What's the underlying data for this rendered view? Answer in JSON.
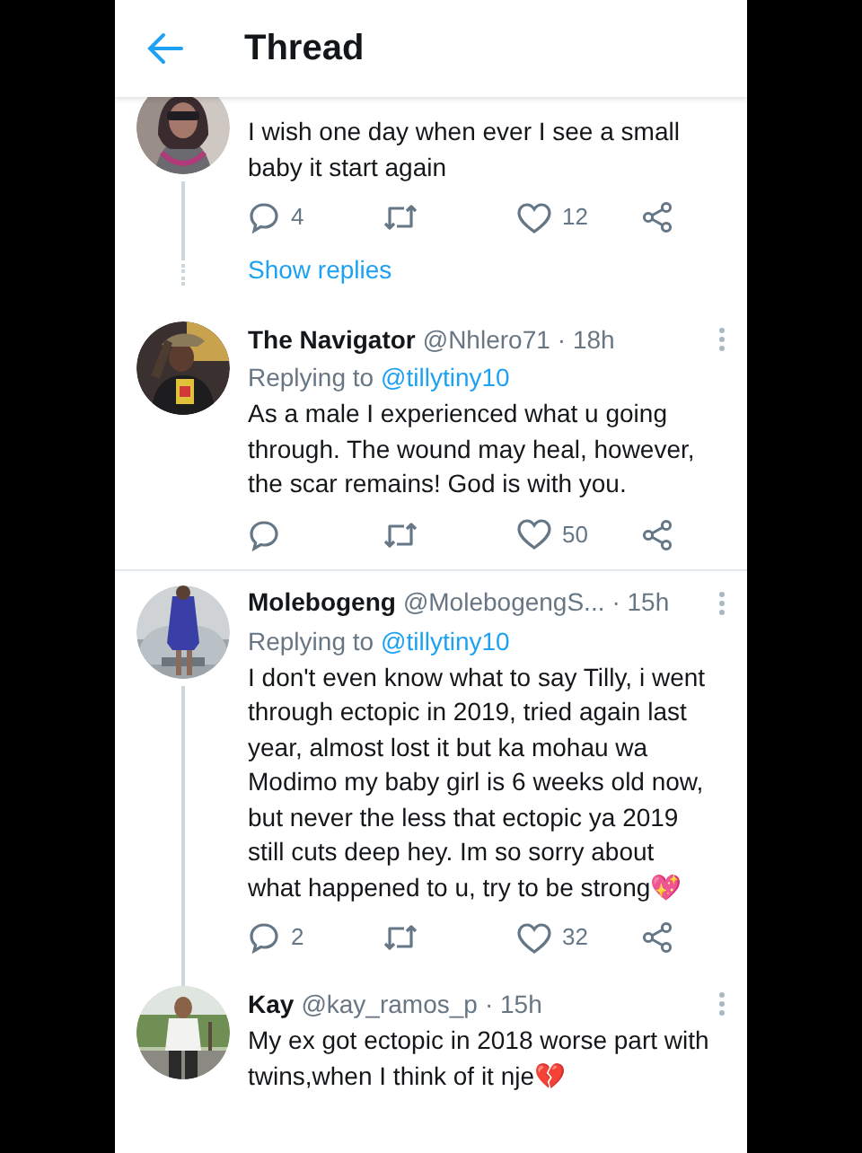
{
  "header": {
    "title": "Thread"
  },
  "tweets": [
    {
      "body": "I wish one day when ever I see a small baby it start again",
      "actions": {
        "replies": "4",
        "likes": "12"
      },
      "show_replies": "Show replies",
      "thread_above": false,
      "thread_below": true
    },
    {
      "name": "The Navigator",
      "handle": "@Nhlero71",
      "time": "· 18h",
      "replying_label": "Replying to",
      "replying_to": "@tillytiny10",
      "body": "As a male I experienced what u going through. The wound may heal, however, the scar remains! God is with you.",
      "actions": {
        "likes": "50"
      },
      "thread_above": false,
      "thread_below": false
    },
    {
      "name": "Molebogeng",
      "handle": "@MolebogengS...",
      "time": "· 15h",
      "replying_label": "Replying to",
      "replying_to": "@tillytiny10",
      "body": "I don't even know what to say Tilly, i went through ectopic in 2019, tried again last year, almost lost it but ka mohau wa Modimo my baby girl is 6 weeks old now, but never the less that ectopic ya 2019 still cuts deep hey. Im so sorry about what happened to u, try to be strong💖",
      "actions": {
        "replies": "2",
        "likes": "32"
      },
      "thread_above": false,
      "thread_below": true
    },
    {
      "name": "Kay",
      "handle": "@kay_ramos_p",
      "time": "· 15h",
      "body": "My ex got ectopic in 2018 worse part with twins,when I think of it nje💔",
      "thread_above": true,
      "thread_below": false
    }
  ]
}
